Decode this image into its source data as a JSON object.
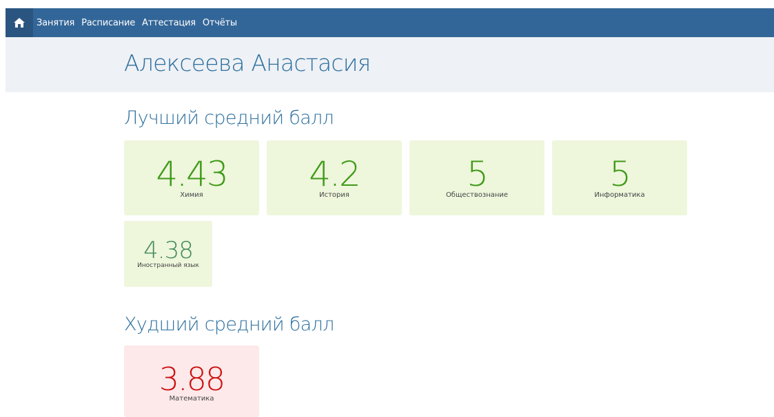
{
  "nav": {
    "home_icon": "home-icon",
    "items": [
      "Занятия",
      "Расписание",
      "Аттестация",
      "Отчёты"
    ]
  },
  "student": {
    "name": "Алексеева Анастасия"
  },
  "best": {
    "title": "Лучший средний балл",
    "cards": [
      {
        "score": "4.43",
        "subject": "Химия"
      },
      {
        "score": "4.2",
        "subject": "История"
      },
      {
        "score": "5",
        "subject": "Обществознание"
      },
      {
        "score": "5",
        "subject": "Информатика"
      },
      {
        "score": "4.38",
        "subject": "Иностранный язык"
      }
    ]
  },
  "worst": {
    "title": "Худший средний балл",
    "cards": [
      {
        "score": "3.88",
        "subject": "Математика"
      }
    ]
  },
  "colors": {
    "nav_bg": "#336698",
    "heading": "#2c6f9e",
    "good_score": "#3e9a17",
    "good_score_alt": "#3f8a58",
    "bad_score": "#cc1111",
    "good_card_bg": "#eef6dc",
    "bad_card_bg": "#fde9ea"
  }
}
